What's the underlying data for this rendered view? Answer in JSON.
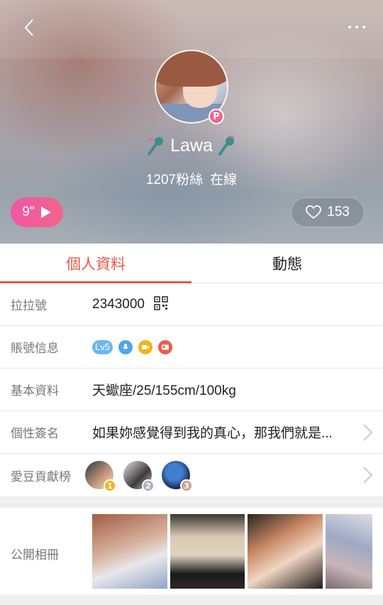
{
  "header": {
    "username": "Lawa",
    "fans_count": "1207粉絲",
    "status": "在線",
    "video_duration": "9\"",
    "likes": "153",
    "badge": "P"
  },
  "tabs": [
    {
      "label": "個人資料",
      "active": true
    },
    {
      "label": "動態",
      "active": false
    }
  ],
  "profile": {
    "id_label": "拉拉號",
    "id_value": "2343000",
    "account_label": "賬號信息",
    "level": "Lv5",
    "basic_label": "基本資料",
    "basic_value": "天蠍座/25/155cm/100kg",
    "signature_label": "個性簽名",
    "signature_value": "如果妳感覺得到我的真心，那我們就是...",
    "rank_label": "愛豆貢獻榜",
    "ranks": [
      "1",
      "2",
      "3"
    ],
    "album_label": "公開相冊"
  },
  "colors": {
    "accent": "#e7584a",
    "video_pink": "#f058a3",
    "level_blue": "#6cb7ee"
  }
}
